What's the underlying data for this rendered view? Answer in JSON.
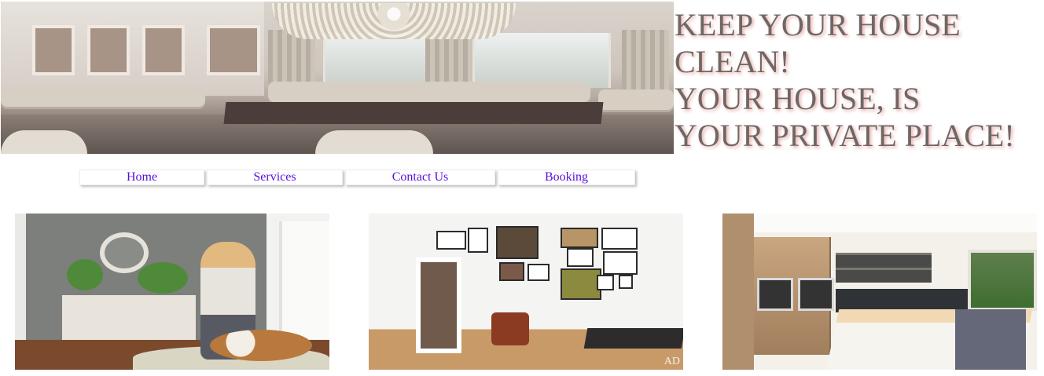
{
  "header": {
    "banner_image": "living-room-chandelier-photo",
    "title_lines": [
      "KEEP YOUR HOUSE",
      "CLEAN!",
      "YOUR HOUSE, IS",
      "YOUR PRIVATE PLACE!"
    ]
  },
  "nav": {
    "items": [
      {
        "label": "Home"
      },
      {
        "label": "Services"
      },
      {
        "label": "Contact Us"
      },
      {
        "label": "Booking"
      }
    ]
  },
  "gallery": {
    "images": [
      {
        "subject": "woman-with-dog-in-entryway-photo"
      },
      {
        "subject": "gallery-wall-living-room-photo",
        "watermark": "AD"
      },
      {
        "subject": "modern-kitchen-island-photo"
      }
    ]
  },
  "colors": {
    "title_text": "#6d6864",
    "title_shadow": "#e9a6a6",
    "nav_link": "#5511dd",
    "background": "#ffffff"
  }
}
